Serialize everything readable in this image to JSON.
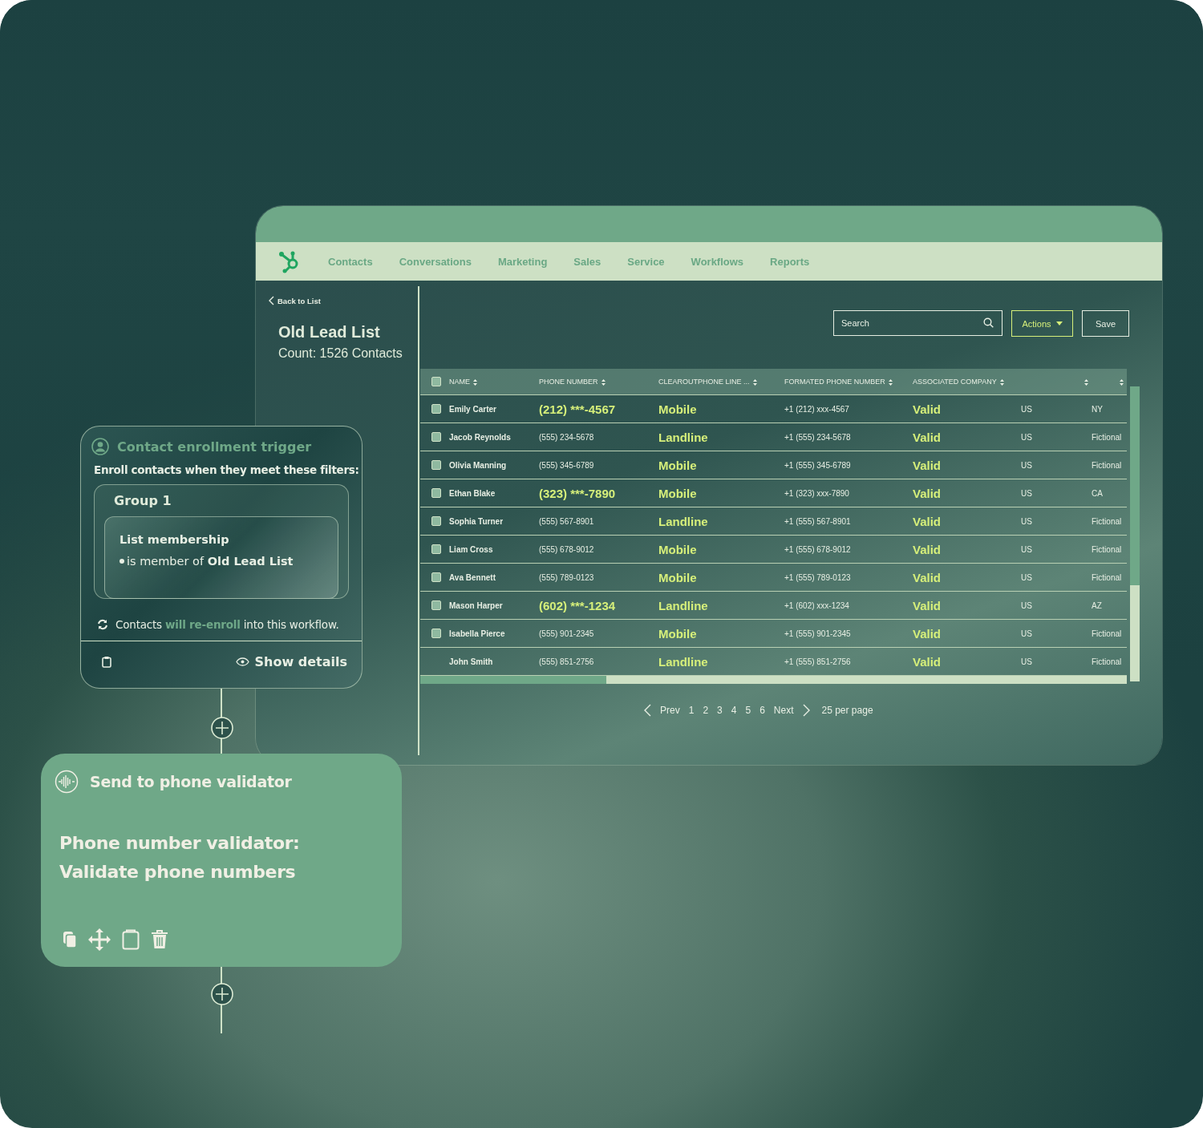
{
  "app_window": {
    "nav": {
      "items": [
        "Contacts",
        "Conversations",
        "Marketing",
        "Sales",
        "Service",
        "Workflows",
        "Reports"
      ]
    },
    "back_link": "Back to List",
    "list_title": "Old Lead List",
    "list_count": "Count: 1526 Contacts",
    "search": {
      "placeholder": "Search"
    },
    "actions_button": "Actions",
    "save_button": "Save",
    "table": {
      "columns": [
        "NAME",
        "PHONE NUMBER",
        "CLEAROUTPHONE LINE ...",
        "FORMATED PHONE NUMBER",
        "ASSOCIATED COMPANY"
      ],
      "header_checked": false,
      "rows": [
        {
          "kind": "selectable",
          "checked": false,
          "name": "Emily Carter",
          "phone": "(212) ***-4567",
          "masked": true,
          "line_type": "Mobile",
          "formatted": "+1 (212) xxx-4567",
          "status": "Valid",
          "country": "US",
          "region": "NY"
        },
        {
          "kind": "selectable",
          "checked": false,
          "name": "Jacob Reynolds",
          "phone": "(555) 234-5678",
          "masked": false,
          "line_type": "Landline",
          "formatted": "+1 (555) 234-5678",
          "status": "Valid",
          "country": "US",
          "region": "Fictional"
        },
        {
          "kind": "selectable",
          "checked": false,
          "name": "Olivia Manning",
          "phone": "(555) 345-6789",
          "masked": false,
          "line_type": "Mobile",
          "formatted": "+1 (555) 345-6789",
          "status": "Valid",
          "country": "US",
          "region": "Fictional"
        },
        {
          "kind": "selectable",
          "checked": false,
          "name": "Ethan Blake",
          "phone": "(323) ***-7890",
          "masked": true,
          "line_type": "Mobile",
          "formatted": "+1 (323) xxx-7890",
          "status": "Valid",
          "country": "US",
          "region": "CA"
        },
        {
          "kind": "selectable",
          "checked": false,
          "name": "Sophia Turner",
          "phone": "(555) 567-8901",
          "masked": false,
          "line_type": "Landline",
          "formatted": "+1 (555) 567-8901",
          "status": "Valid",
          "country": "US",
          "region": "Fictional"
        },
        {
          "kind": "selectable",
          "checked": false,
          "name": "Liam Cross",
          "phone": "(555) 678-9012",
          "masked": false,
          "line_type": "Mobile",
          "formatted": "+1 (555) 678-9012",
          "status": "Valid",
          "country": "US",
          "region": "Fictional"
        },
        {
          "kind": "selectable",
          "checked": false,
          "name": "Ava Bennett",
          "phone": "(555) 789-0123",
          "masked": false,
          "line_type": "Mobile",
          "formatted": "+1 (555) 789-0123",
          "status": "Valid",
          "country": "US",
          "region": "Fictional"
        },
        {
          "kind": "selectable",
          "checked": false,
          "name": "Mason Harper",
          "phone": "(602) ***-1234",
          "masked": true,
          "line_type": "Landline",
          "formatted": "+1 (602) xxx-1234",
          "status": "Valid",
          "country": "US",
          "region": "AZ"
        },
        {
          "kind": "selectable",
          "checked": false,
          "name": "Isabella Pierce",
          "phone": "(555) 901-2345",
          "masked": false,
          "line_type": "Mobile",
          "formatted": "+1 (555) 901-2345",
          "status": "Valid",
          "country": "US",
          "region": "Fictional"
        },
        {
          "kind": "plain",
          "name": "John Smith",
          "phone": "(555) 851-2756",
          "masked": false,
          "line_type": "Landline",
          "formatted": "+1 (555) 851-2756",
          "status": "Valid",
          "country": "US",
          "region": "Fictional"
        }
      ]
    },
    "pagination": {
      "prev": "Prev",
      "pages": [
        "1",
        "2",
        "3",
        "4",
        "5",
        "6"
      ],
      "next": "Next",
      "per_page": "25 per page"
    }
  },
  "trigger_card": {
    "title": "Contact enrollment trigger",
    "subtitle": "Enroll contacts when they meet these filters:",
    "group_title": "Group 1",
    "filter_title": "List membership",
    "filter_text": "is member of **Old Lead List**",
    "reenroll_note": "Contacts **will re-enroll** into this workflow.",
    "show_details": "Show details"
  },
  "validator_card": {
    "title": "Send to phone validator",
    "body_lines": [
      "Phone number validator:",
      "Validate phone numbers"
    ]
  }
}
